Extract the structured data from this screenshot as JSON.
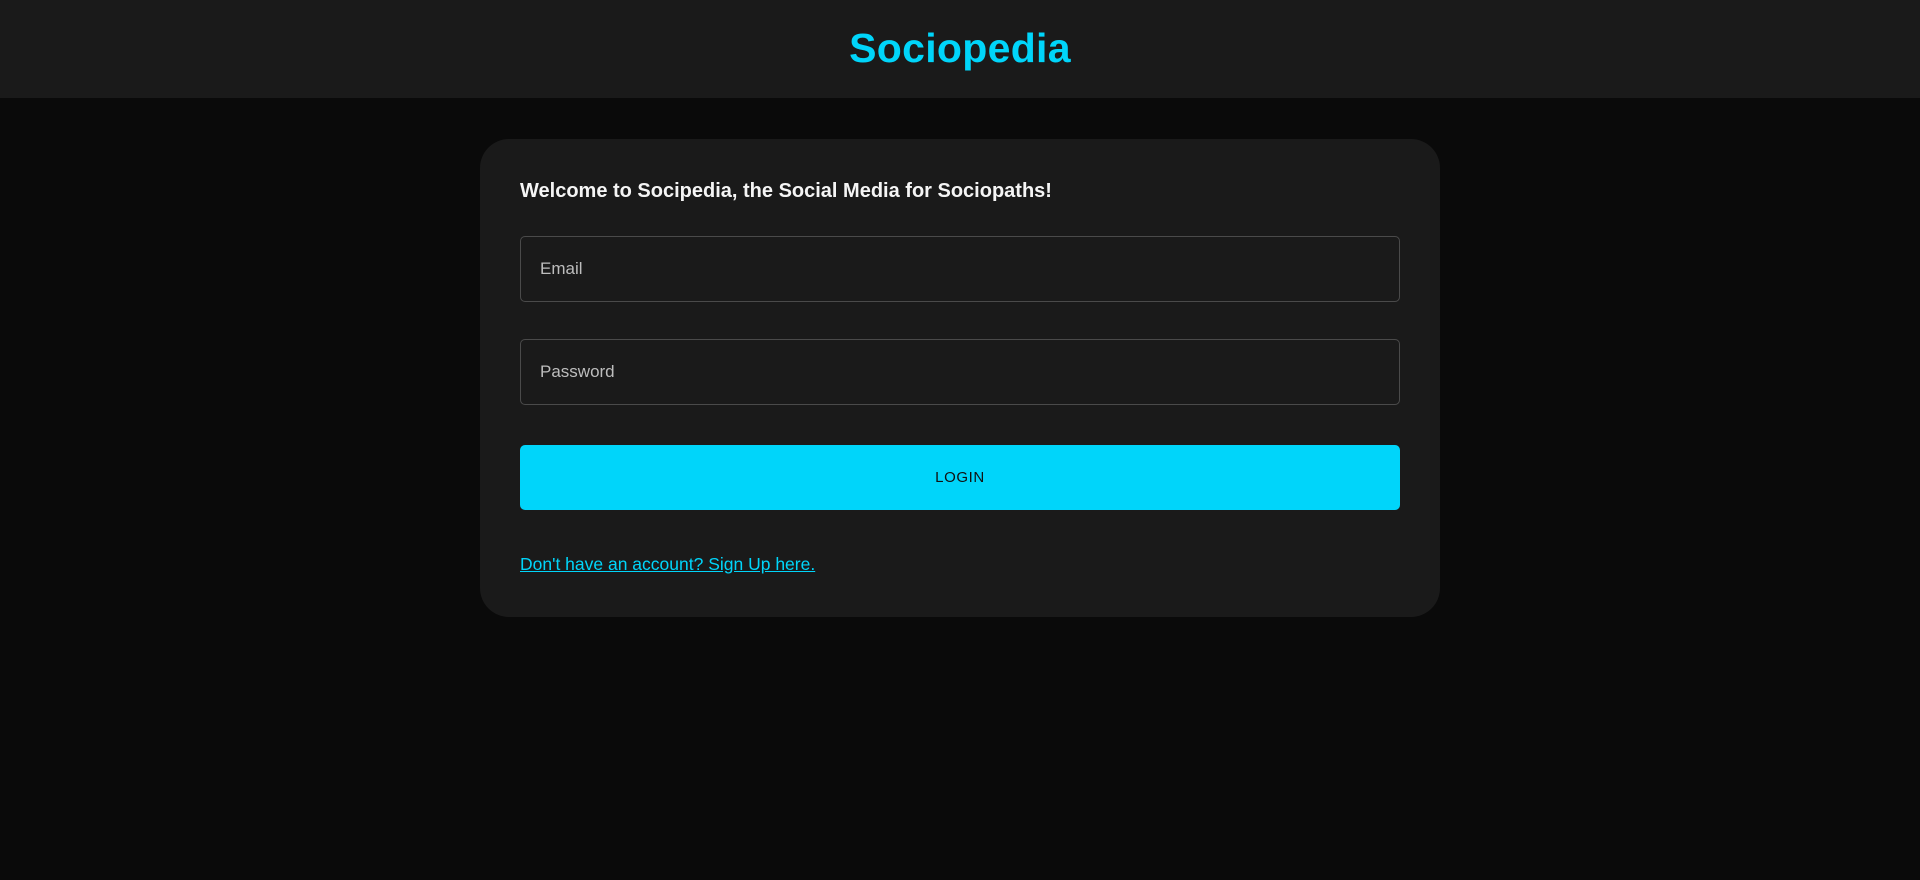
{
  "header": {
    "brand": "Sociopedia"
  },
  "login_card": {
    "welcome_text": "Welcome to Socipedia, the Social Media for Sociopaths!",
    "email": {
      "placeholder": "Email",
      "value": ""
    },
    "password": {
      "placeholder": "Password",
      "value": ""
    },
    "login_label": "LOGIN",
    "signup_link": "Don't have an account? Sign Up here."
  },
  "colors": {
    "accent": "#00d5fa",
    "page_background": "#0a0a0a",
    "surface": "#1a1a1a"
  }
}
